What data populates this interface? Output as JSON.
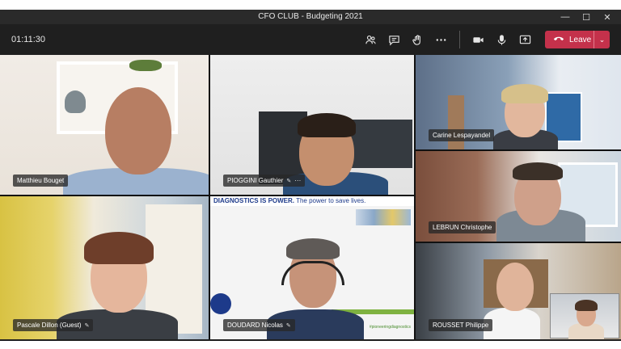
{
  "window": {
    "title": "CFO CLUB - Budgeting 2021",
    "minimize_glyph": "—",
    "maximize_glyph": "☐",
    "close_glyph": "✕"
  },
  "toolbar": {
    "timer": "01:11:30",
    "icons": [
      "participants-icon",
      "chat-icon",
      "raise-hand-icon",
      "more-options-icon",
      "camera-icon",
      "microphone-icon",
      "share-screen-icon"
    ],
    "leave_label": "Leave",
    "leave_color": "#c4314b"
  },
  "participants": [
    {
      "name": "Matthieu Bouget",
      "mic": ""
    },
    {
      "name": "PIOGGINI Gauthier",
      "mic": "✎",
      "more": "···"
    },
    {
      "name": "Carine Lespayandel",
      "mic": ""
    },
    {
      "name": "LEBRUN Christophe",
      "mic": ""
    },
    {
      "name": "Pascale Dillon (Guest)",
      "mic": "✎"
    },
    {
      "name": "DOUDARD Nicolas",
      "mic": "✎"
    },
    {
      "name": "ROUSSET Philippe",
      "mic": ""
    }
  ],
  "shared_banner": {
    "bold": "DIAGNOSTICS IS POWER.",
    "rest": " The power to save lives.",
    "hashtag": "#pioneeringdiagnostics"
  }
}
